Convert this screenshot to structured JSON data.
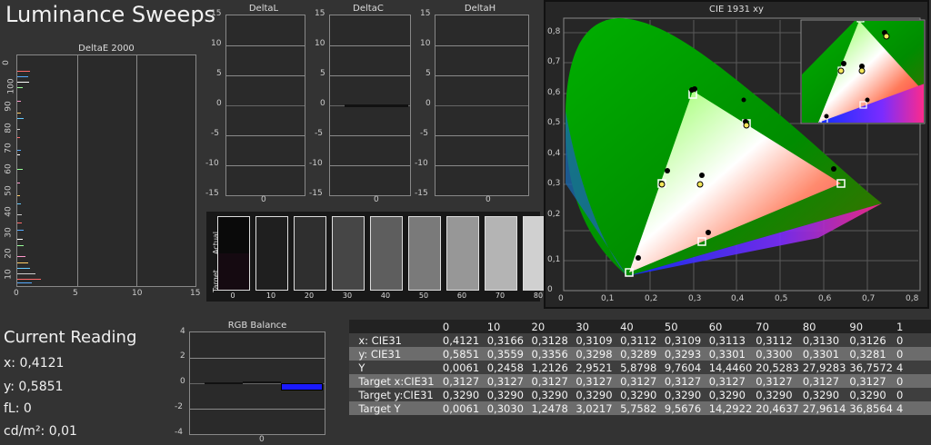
{
  "app": {
    "title": "Luminance Sweeps"
  },
  "deltae": {
    "title": "DeltaE 2000",
    "x_ticks": [
      "0",
      "5",
      "10",
      "15"
    ],
    "y_ticks": [
      "0",
      "100",
      "90",
      "80",
      "70",
      "60",
      "50",
      "40",
      "30",
      "20",
      "10"
    ]
  },
  "deltal": {
    "title": "DeltaL"
  },
  "deltac": {
    "title": "DeltaC"
  },
  "deltah": {
    "title": "DeltaH"
  },
  "delta_y_ticks": [
    "15",
    "10",
    "5",
    "0",
    "-5",
    "-10",
    "-15"
  ],
  "delta_x_tick": "0",
  "swatches": {
    "actual_label": "Actual",
    "target_label": "Target",
    "levels": [
      "0",
      "10",
      "20",
      "30",
      "40",
      "50",
      "60",
      "70",
      "80"
    ],
    "actual_colors": [
      "#0a0a0a",
      "#1f1f1f",
      "#2f2f2f",
      "#464646",
      "#5e5e5e",
      "#7a7a7a",
      "#979797",
      "#b4b4b4",
      "#d0d0d0"
    ],
    "target_colors": [
      "#150a11",
      "#1f1f1f",
      "#2f2f2f",
      "#464646",
      "#5e5e5e",
      "#7a7a7a",
      "#979797",
      "#b4b4b4",
      "#d0d0d0"
    ]
  },
  "cie": {
    "title": "CIE 1931 xy",
    "x_ticks": [
      "0",
      "0,1",
      "0,2",
      "0,3",
      "0,4",
      "0,5",
      "0,6",
      "0,7",
      "0,8"
    ],
    "y_ticks": [
      "0,8",
      "0,7",
      "0,6",
      "0,5",
      "0,4",
      "0,3",
      "0,2",
      "0,1",
      "0"
    ]
  },
  "rgb_balance": {
    "title": "RGB Balance",
    "y_ticks": [
      "4",
      "2",
      "0",
      "-2",
      "-4"
    ],
    "x_tick": "0"
  },
  "current_reading": {
    "title": "Current Reading",
    "x": "x: 0,4121",
    "y": "y: 0,5851",
    "fl": "fL: 0",
    "cdm2": "cd/m²: 0,01"
  },
  "table": {
    "columns": [
      "0",
      "10",
      "20",
      "30",
      "40",
      "50",
      "60",
      "70",
      "80",
      "90",
      "1"
    ],
    "rows": [
      {
        "label": "x: CIE31",
        "values": [
          "0,4121",
          "0,3166",
          "0,3128",
          "0,3109",
          "0,3112",
          "0,3109",
          "0,3113",
          "0,3112",
          "0,3130",
          "0,3126",
          "0"
        ]
      },
      {
        "label": "y: CIE31",
        "values": [
          "0,5851",
          "0,3559",
          "0,3356",
          "0,3298",
          "0,3289",
          "0,3293",
          "0,3301",
          "0,3300",
          "0,3301",
          "0,3281",
          "0"
        ]
      },
      {
        "label": "Y",
        "values": [
          "0,0061",
          "0,2458",
          "1,2126",
          "2,9521",
          "5,8798",
          "9,7604",
          "14,4460",
          "20,5283",
          "27,9283",
          "36,7572",
          "4"
        ]
      },
      {
        "label": "Target x:CIE31",
        "values": [
          "0,3127",
          "0,3127",
          "0,3127",
          "0,3127",
          "0,3127",
          "0,3127",
          "0,3127",
          "0,3127",
          "0,3127",
          "0,3127",
          "0"
        ]
      },
      {
        "label": "Target y:CIE31",
        "values": [
          "0,3290",
          "0,3290",
          "0,3290",
          "0,3290",
          "0,3290",
          "0,3290",
          "0,3290",
          "0,3290",
          "0,3290",
          "0,3290",
          "0"
        ]
      },
      {
        "label": "Target Y",
        "values": [
          "0,0061",
          "0,3030",
          "1,2478",
          "3,0217",
          "5,7582",
          "9,5676",
          "14,2922",
          "20,4637",
          "27,9614",
          "36,8564",
          "4"
        ]
      }
    ]
  },
  "colors": {
    "background": "#333333",
    "rgb_blue_bar": "#1a1aff"
  }
}
